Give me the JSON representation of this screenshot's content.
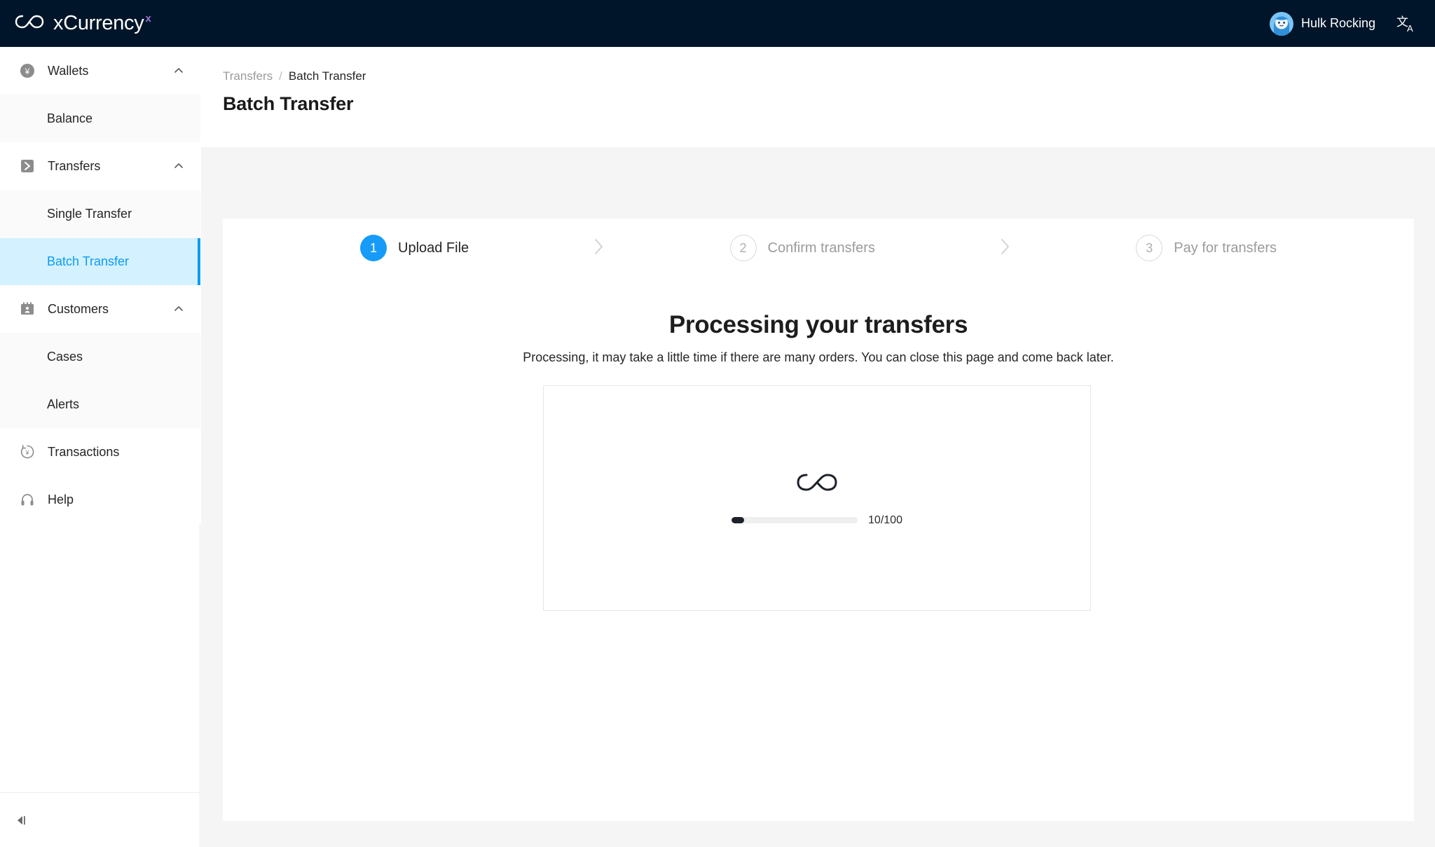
{
  "app": {
    "brand_name": "xCurrency",
    "brand_mark": "x",
    "brand_logo_icon": "infinity-icon"
  },
  "topbar": {
    "user_name": "Hulk Rocking",
    "avatar_icon": "user-avatar-icon",
    "language_icon": "translate-icon"
  },
  "sidebar": {
    "groups": [
      {
        "label": "Wallets",
        "icon": "wallet-currency-icon",
        "expanded": true,
        "children": [
          {
            "label": "Balance",
            "active": false
          }
        ]
      },
      {
        "label": "Transfers",
        "icon": "transfer-arrow-icon",
        "expanded": true,
        "children": [
          {
            "label": "Single Transfer",
            "active": false
          },
          {
            "label": "Batch Transfer",
            "active": true
          }
        ]
      },
      {
        "label": "Customers",
        "icon": "customers-id-card-icon",
        "expanded": true,
        "children": [
          {
            "label": "Cases",
            "active": false
          },
          {
            "label": "Alerts",
            "active": false
          }
        ]
      }
    ],
    "flat_items": [
      {
        "label": "Transactions",
        "icon": "transaction-history-icon"
      },
      {
        "label": "Help",
        "icon": "headset-icon"
      }
    ],
    "collapse_icon": "collapse-sidebar-icon"
  },
  "breadcrumb": {
    "parent": "Transfers",
    "separator": "/",
    "current": "Batch Transfer"
  },
  "page": {
    "title": "Batch Transfer"
  },
  "stepper": {
    "steps": [
      {
        "number": "1",
        "label": "Upload File",
        "state": "active"
      },
      {
        "number": "2",
        "label": "Confirm transfers",
        "state": "idle"
      },
      {
        "number": "3",
        "label": "Pay for transfers",
        "state": "idle"
      }
    ],
    "separator_icon": "chevron-right-icon"
  },
  "processing": {
    "title": "Processing your transfers",
    "subtitle": "Processing, it may take a little time if there are many orders. You can close this page and come back later.",
    "loader_icon": "infinity-loader-icon",
    "progress_label": "10/100",
    "progress_current": 10,
    "progress_total": 100,
    "progress_percent": 10
  },
  "colors": {
    "topbar_bg": "#001529",
    "accent_blue": "#169bf8",
    "active_nav_bg": "#d4f1ff",
    "content_bg": "#f5f5f5",
    "progress_fill": "#1d2129"
  }
}
